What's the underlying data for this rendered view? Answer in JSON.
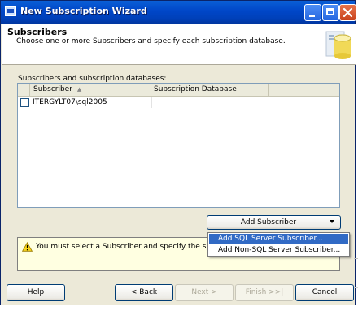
{
  "window": {
    "title": "New Subscription Wizard"
  },
  "header": {
    "title": "Subscribers",
    "subtitle": "Choose one or more Subscribers and specify each subscription database."
  },
  "subscribers": {
    "label": "Subscribers and subscription databases:",
    "columns": [
      "Subscriber",
      "Subscription Database"
    ],
    "rows": [
      {
        "checked": false,
        "subscriber": "ITERGYLT07\\sql2005",
        "database": ""
      }
    ]
  },
  "add_subscriber": {
    "label": "Add Subscriber",
    "menu": [
      "Add SQL Server Subscriber...",
      "Add Non-SQL Server Subscriber..."
    ],
    "selected_index": 0
  },
  "message": {
    "text": "You must select a Subscriber and specify the subscription database."
  },
  "buttons": {
    "help": "Help",
    "back": "< Back",
    "next": "Next >",
    "finish": "Finish >>|",
    "cancel": "Cancel"
  },
  "icons": {
    "app": "wizard-app-icon",
    "header": "database-server-icon",
    "warning": "warning-icon",
    "sort": "sort-ascending-icon"
  }
}
